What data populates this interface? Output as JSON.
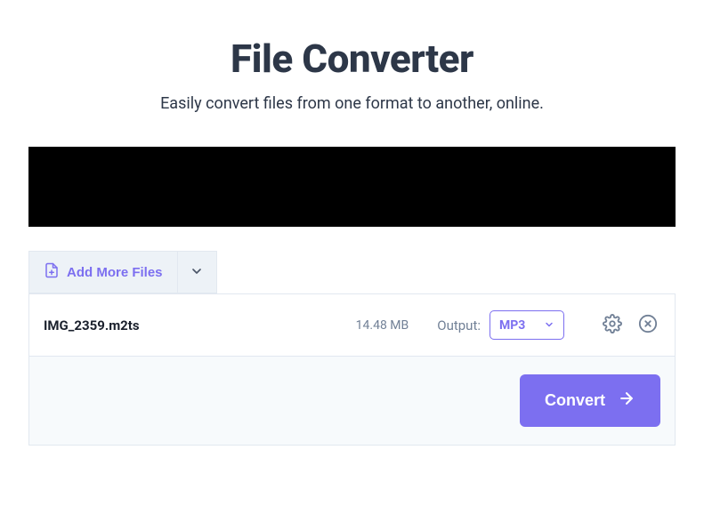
{
  "header": {
    "title": "File Converter",
    "subtitle": "Easily convert files from one format to another, online."
  },
  "toolbar": {
    "add_more_label": "Add More Files"
  },
  "file": {
    "name": "IMG_2359.m2ts",
    "size": "14.48 MB",
    "output_label": "Output:",
    "format": "MP3"
  },
  "actions": {
    "convert_label": "Convert"
  }
}
